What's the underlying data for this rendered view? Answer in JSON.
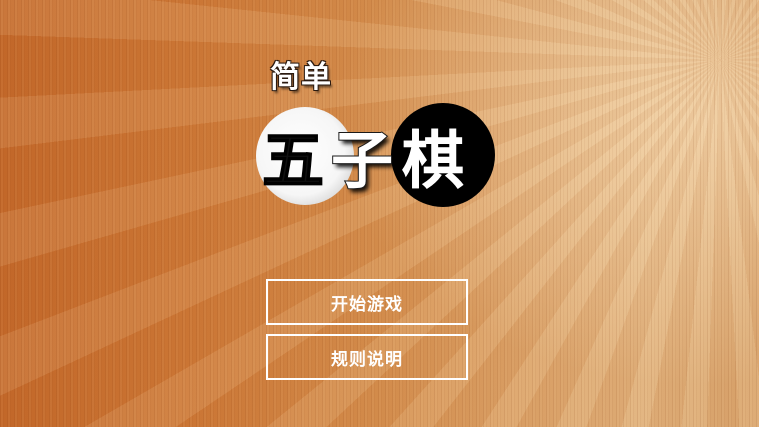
{
  "app": {
    "title_small": "简单",
    "logo_chars": [
      "五",
      "子",
      "棋"
    ]
  },
  "menu": {
    "start_label": "开始游戏",
    "rules_label": "规则说明"
  },
  "colors": {
    "wood_dark": "#c4692a",
    "wood_light": "#e0b07a",
    "white_stone": "#ffffff",
    "black_stone": "#000000",
    "button_border": "#ffffff"
  }
}
